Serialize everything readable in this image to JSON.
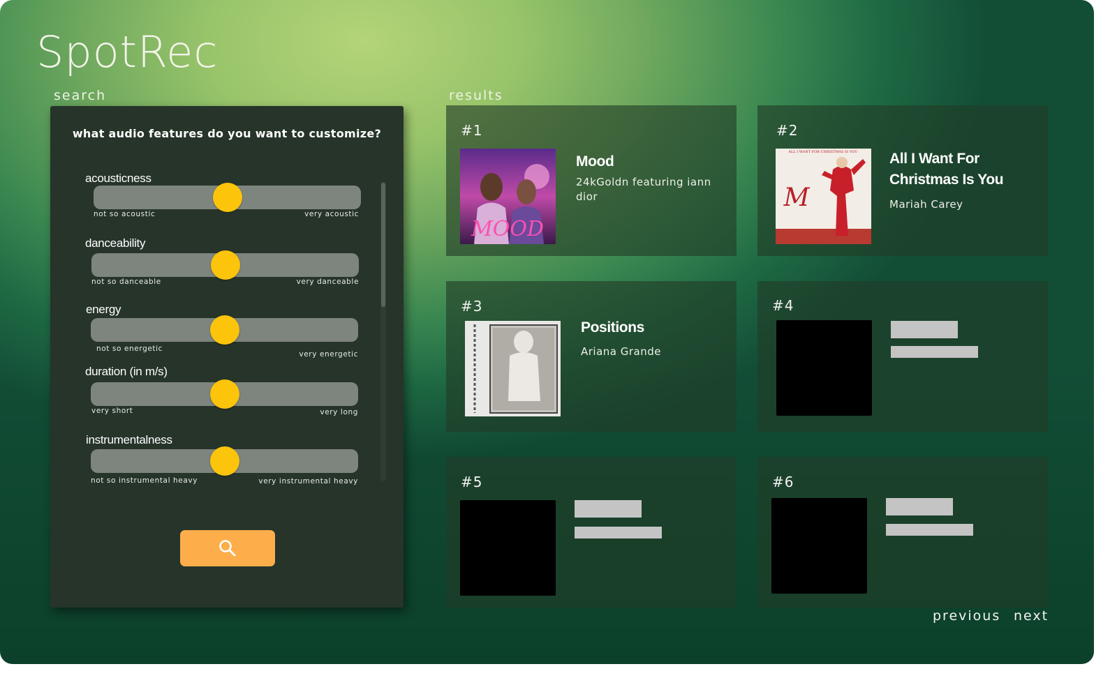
{
  "app": {
    "title": "SpotRec"
  },
  "search": {
    "label": "search",
    "question": "what audio features do you want to customize?",
    "sliders": [
      {
        "name": "acousticness",
        "min_label": "not so acoustic",
        "max_label": "very acoustic",
        "value": 0.5
      },
      {
        "name": "danceability",
        "min_label": "not so danceable",
        "max_label": "very danceable",
        "value": 0.5
      },
      {
        "name": "energy",
        "min_label": "not so energetic",
        "max_label": "very energetic",
        "value": 0.5
      },
      {
        "name": "duration (in m/s)",
        "min_label": "very short",
        "max_label": "very long",
        "value": 0.5
      },
      {
        "name": "instrumentalness",
        "min_label": "not so instrumental heavy",
        "max_label": "very instrumental heavy",
        "value": 0.5
      }
    ],
    "button_icon": "search-icon"
  },
  "results": {
    "label": "results",
    "cards": [
      {
        "rank": "#1",
        "title": "Mood",
        "artist": "24kGoldn featuring iann dior",
        "cover": "mood-album-cover"
      },
      {
        "rank": "#2",
        "title": "All I Want For Christmas Is You",
        "artist": "Mariah Carey",
        "cover": "merry-christmas-album-cover"
      },
      {
        "rank": "#3",
        "title": "Positions",
        "artist": "Ariana Grande",
        "cover": "positions-album-cover"
      },
      {
        "rank": "#4",
        "title": "",
        "artist": "",
        "cover": "placeholder"
      },
      {
        "rank": "#5",
        "title": "",
        "artist": "",
        "cover": "placeholder"
      },
      {
        "rank": "#6",
        "title": "",
        "artist": "",
        "cover": "placeholder"
      }
    ]
  },
  "pagination": {
    "previous": "previous",
    "next": "next"
  },
  "colors": {
    "accent_button": "#fdae4b",
    "slider_thumb": "#fcc40a",
    "slider_track": "#7e857e",
    "panel": "#26342a"
  }
}
